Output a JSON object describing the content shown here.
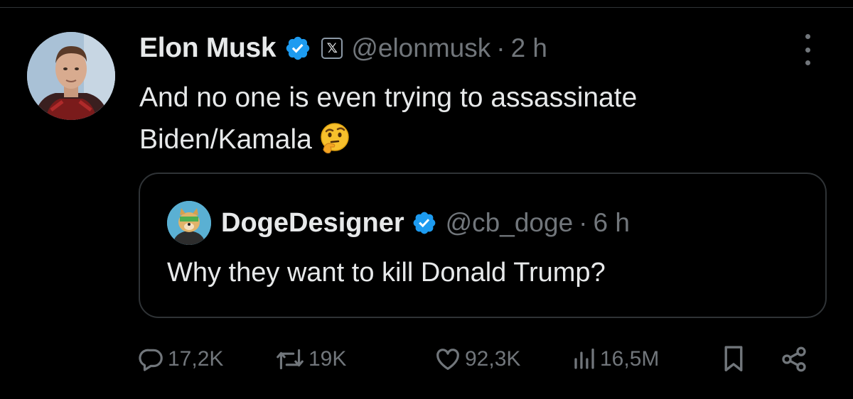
{
  "tweet": {
    "author_name": "Elon Musk",
    "affiliate_label": "𝕏",
    "handle": "@elonmusk",
    "separator": "·",
    "time": "2 h",
    "text_line1": "And no one is even trying to assassinate",
    "text_line2": "Biden/Kamala",
    "emoji": "thinking-face"
  },
  "quote": {
    "author_name": "DogeDesigner",
    "handle": "@cb_doge",
    "separator": "·",
    "time": "6 h",
    "text": "Why they want to kill Donald Trump?"
  },
  "actions": {
    "replies": "17,2K",
    "reposts": "19K",
    "likes": "92,3K",
    "views": "16,5M"
  },
  "colors": {
    "background": "#000000",
    "text_primary": "#e7e9ea",
    "text_secondary": "#71767b",
    "verified_blue": "#1d9bf0",
    "border": "#2f3336"
  }
}
